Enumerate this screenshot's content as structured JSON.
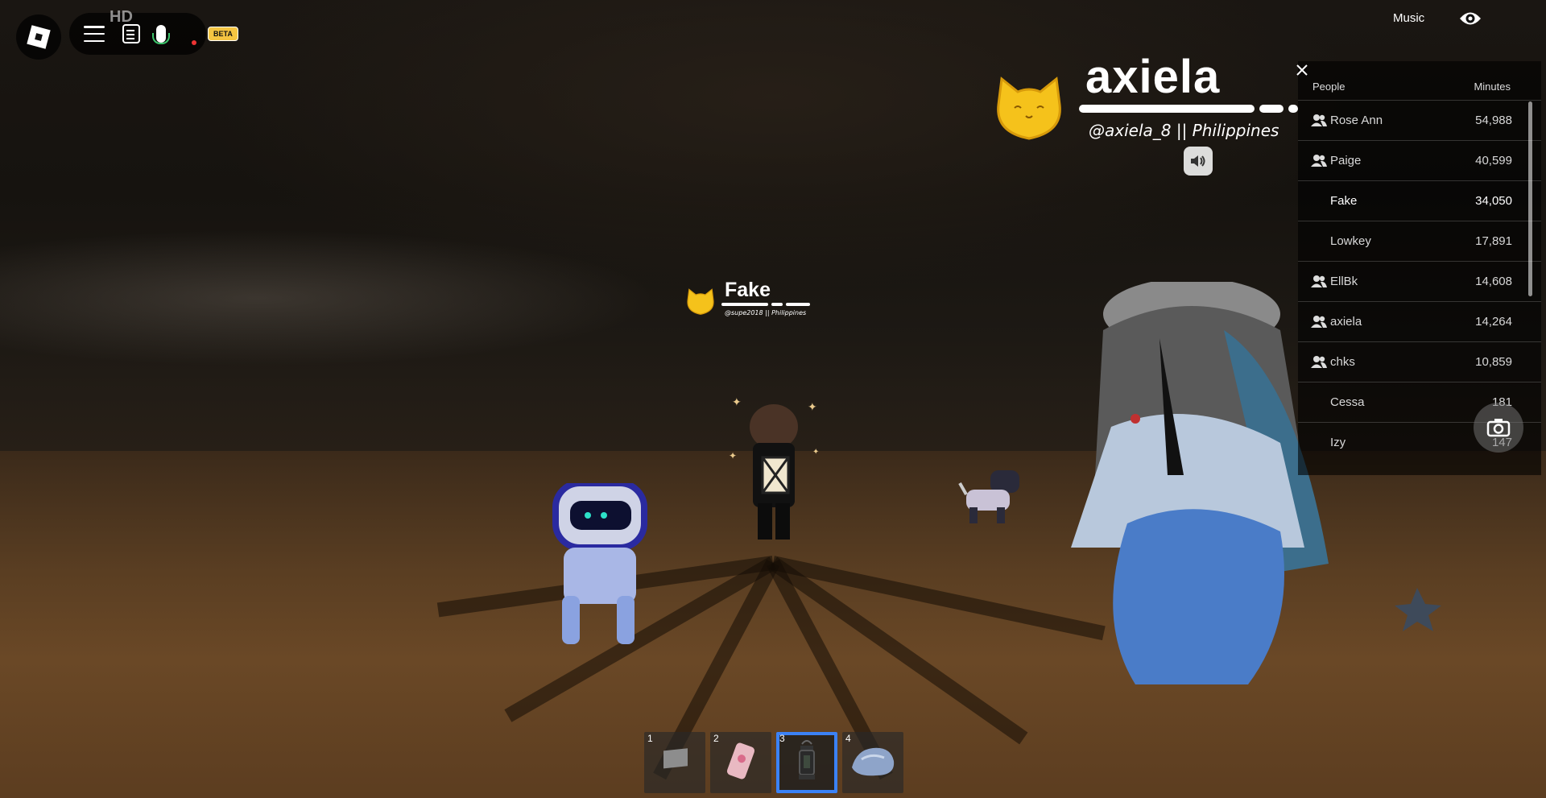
{
  "top_menu": {
    "hd_label": "HD",
    "beta_label": "BETA"
  },
  "top_right": {
    "music_label": "Music"
  },
  "nametag_main": {
    "name": "axiela",
    "handle": "@axiela_8 || Philippines"
  },
  "nametag_small": {
    "name": "Fake",
    "handle": "@supe2018 || Philippines"
  },
  "leaderboard": {
    "col_people": "People",
    "col_minutes": "Minutes",
    "rows": [
      {
        "name": "Rose Ann",
        "minutes": "54,988",
        "friend": true
      },
      {
        "name": "Paige",
        "minutes": "40,599",
        "friend": true
      },
      {
        "name": "Fake",
        "minutes": "34,050",
        "friend": false
      },
      {
        "name": "Lowkey",
        "minutes": "17,891",
        "friend": false
      },
      {
        "name": "EllBk",
        "minutes": "14,608",
        "friend": true
      },
      {
        "name": "axiela",
        "minutes": "14,264",
        "friend": true
      },
      {
        "name": "chks",
        "minutes": "10,859",
        "friend": true
      },
      {
        "name": "Cessa",
        "minutes": "181",
        "friend": false
      },
      {
        "name": "Izy",
        "minutes": "147",
        "friend": false
      }
    ]
  },
  "hotbar": {
    "slots": [
      {
        "num": "1",
        "icon": "flag-icon",
        "selected": false
      },
      {
        "num": "2",
        "icon": "phone-icon",
        "selected": false
      },
      {
        "num": "3",
        "icon": "lantern-icon",
        "selected": true
      },
      {
        "num": "4",
        "icon": "rock-icon",
        "selected": false
      }
    ]
  },
  "colors": {
    "accent_selected": "#3b82f6",
    "beta_badge": "#f5c542",
    "mic_active": "#3cc46b"
  }
}
